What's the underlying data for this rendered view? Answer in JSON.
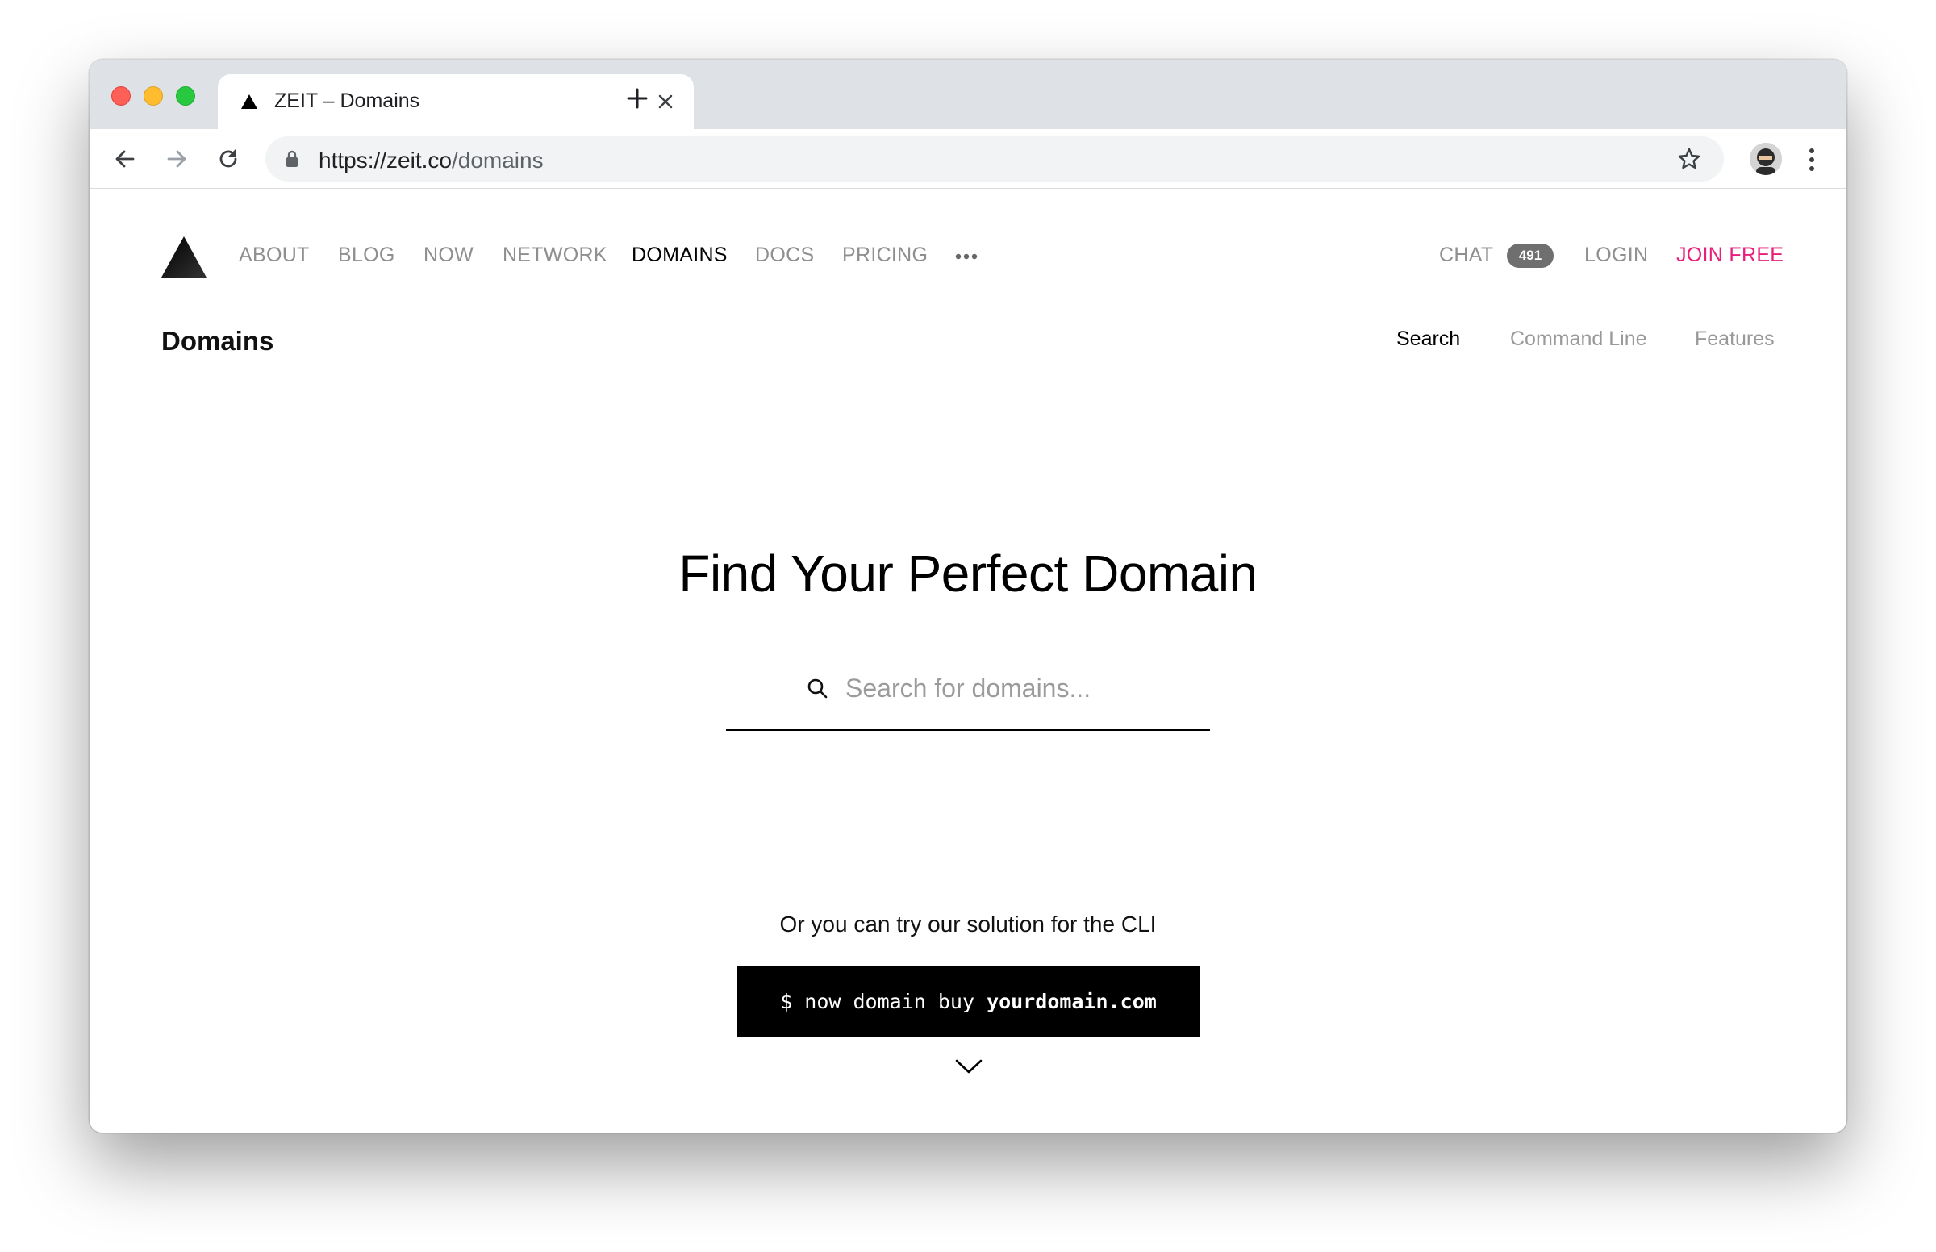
{
  "browser": {
    "tab_title": "ZEIT – Domains",
    "url_host": "https://zeit.co",
    "url_path": "/domains"
  },
  "nav": {
    "items": [
      {
        "label": "ABOUT",
        "active": false
      },
      {
        "label": "BLOG",
        "active": false
      },
      {
        "label": "NOW",
        "active": false
      },
      {
        "label": "NETWORK",
        "active": false
      },
      {
        "label": "DOMAINS",
        "active": true
      },
      {
        "label": "DOCS",
        "active": false
      },
      {
        "label": "PRICING",
        "active": false
      }
    ],
    "chat_label": "CHAT",
    "chat_count": "491",
    "login_label": "LOGIN",
    "join_label": "JOIN FREE"
  },
  "subnav": {
    "title": "Domains",
    "links": [
      {
        "label": "Search",
        "active": true
      },
      {
        "label": "Command Line",
        "active": false
      },
      {
        "label": "Features",
        "active": false
      }
    ]
  },
  "hero": {
    "title": "Find Your Perfect Domain",
    "search_placeholder": "Search for domains...",
    "search_value": ""
  },
  "cli": {
    "intro": "Or you can try our solution for the CLI",
    "command_prefix": "$ now domain buy ",
    "command_arg": "yourdomain.com"
  },
  "colors": {
    "accent": "#e91e7a",
    "tabstrip": "#dee1e6",
    "omnibox": "#f1f3f4"
  }
}
